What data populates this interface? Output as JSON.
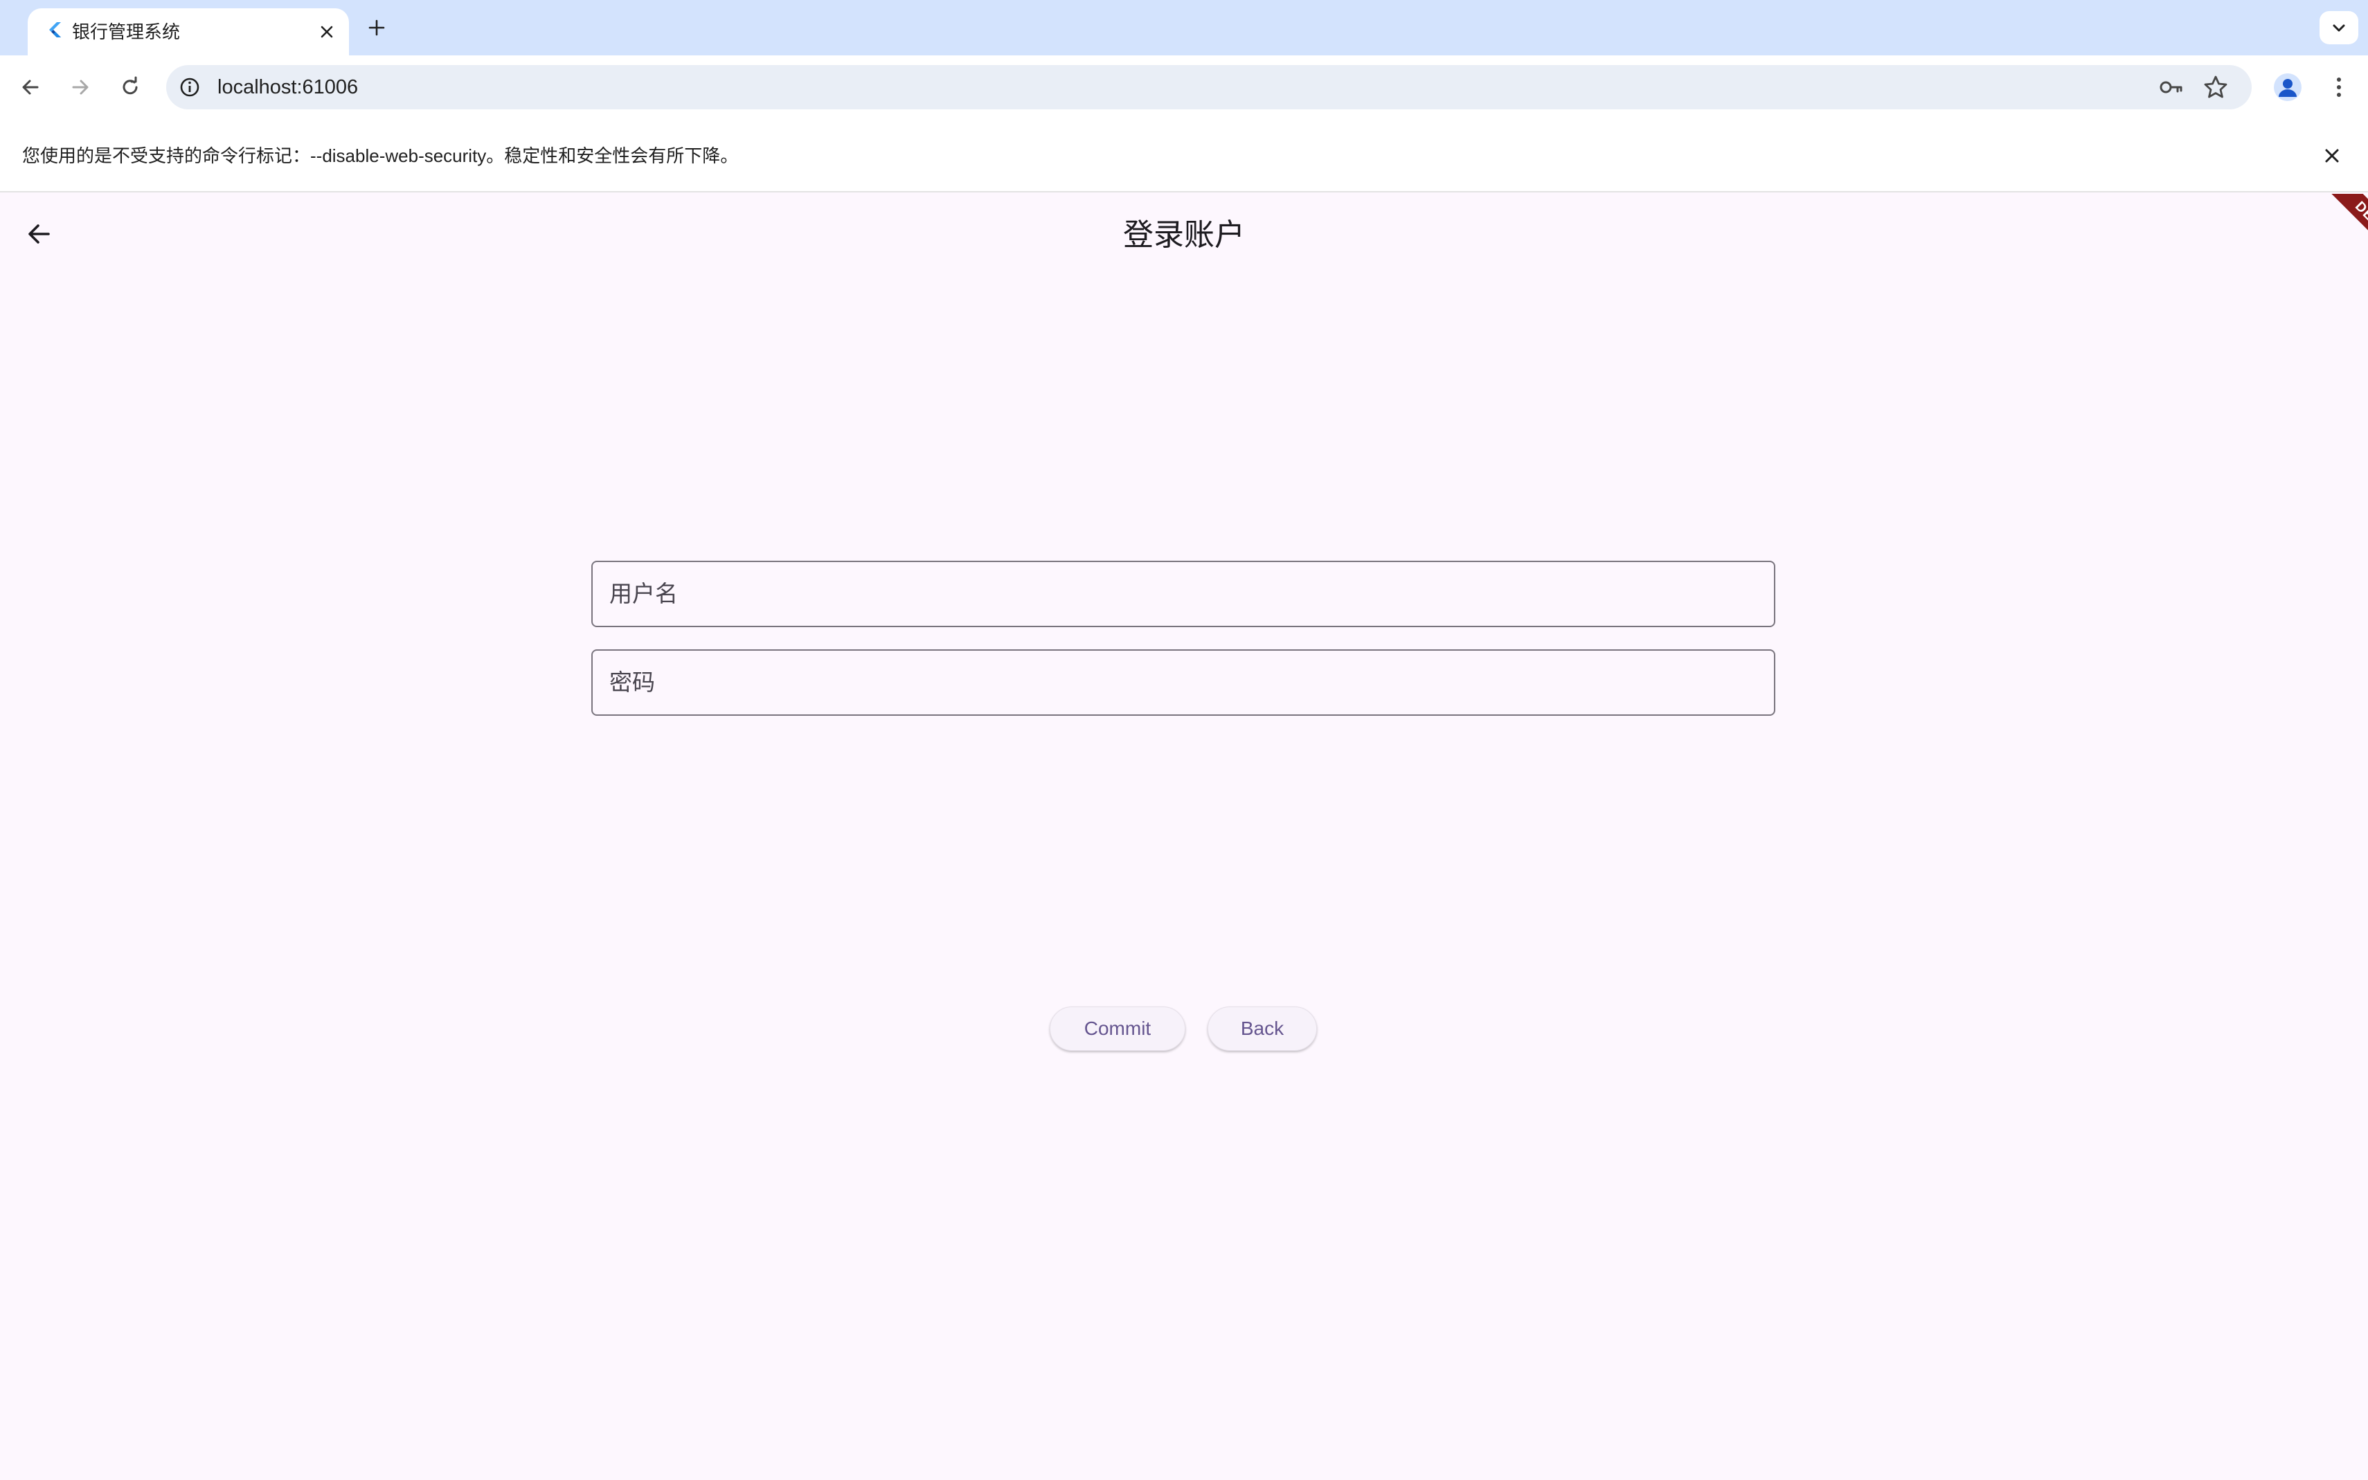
{
  "browser": {
    "tab_title": "银行管理系统",
    "url": "localhost:61006",
    "infobar_message": "您使用的是不受支持的命令行标记：--disable-web-security。稳定性和安全性会有所下降。",
    "icons": {
      "favicon": "flutter-icon",
      "tab_close": "close-icon",
      "new_tab": "plus-icon",
      "tab_search": "chevron-down-icon",
      "back": "arrow-left-icon",
      "forward": "arrow-right-icon",
      "reload": "reload-icon",
      "site_info": "info-icon",
      "passwords": "key-icon",
      "bookmark": "star-icon",
      "profile": "avatar-icon",
      "menu": "more-vert-icon",
      "infobar_close": "close-icon"
    }
  },
  "app": {
    "title": "登录账户",
    "debug_banner": "DEBUG",
    "username_placeholder": "用户名",
    "password_placeholder": "密码",
    "commit_label": "Commit",
    "back_label": "Back",
    "colors": {
      "background": "#fdf7fe",
      "button_text": "#65558f",
      "field_border": "#79747e",
      "debug_banner": "#8b1a1a"
    }
  }
}
